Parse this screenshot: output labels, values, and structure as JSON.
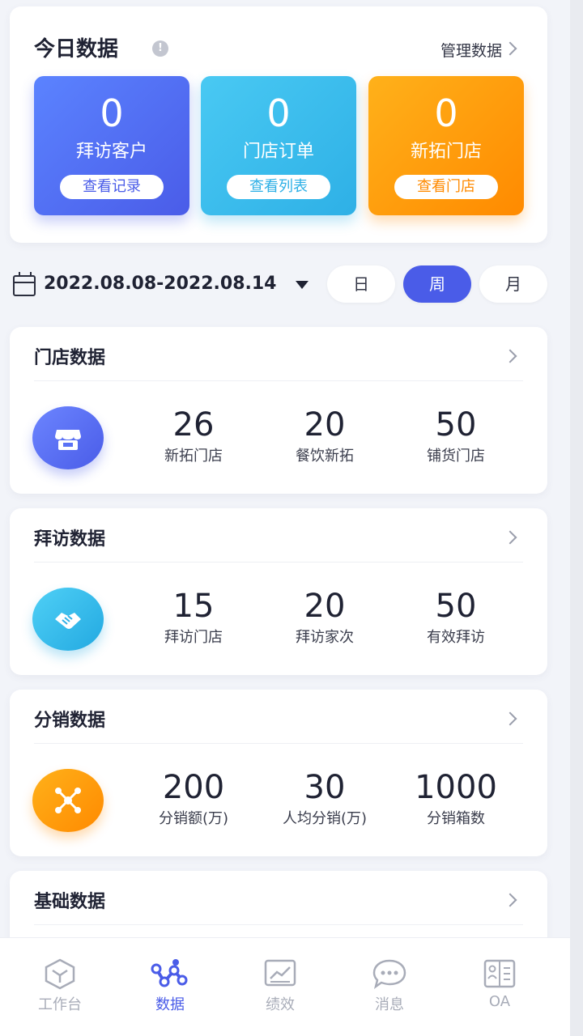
{
  "today": {
    "title": "今日数据",
    "manage_label": "管理数据",
    "tiles": [
      {
        "value": "0",
        "label": "拜访客户",
        "button": "查看记录"
      },
      {
        "value": "0",
        "label": "门店订单",
        "button": "查看列表"
      },
      {
        "value": "0",
        "label": "新拓门店",
        "button": "查看门店"
      }
    ]
  },
  "date_range": "2022.08.08-2022.08.14",
  "period_tabs": [
    "日",
    "周",
    "月"
  ],
  "selected_period": "周",
  "sections": [
    {
      "title": "门店数据",
      "icon": "store-icon",
      "metrics": [
        {
          "value": "26",
          "label": "新拓门店"
        },
        {
          "value": "20",
          "label": "餐饮新拓"
        },
        {
          "value": "50",
          "label": "铺货门店"
        }
      ]
    },
    {
      "title": "拜访数据",
      "icon": "handshake-icon",
      "metrics": [
        {
          "value": "15",
          "label": "拜访门店"
        },
        {
          "value": "20",
          "label": "拜访家次"
        },
        {
          "value": "50",
          "label": "有效拜访"
        }
      ]
    },
    {
      "title": "分销数据",
      "icon": "network-icon",
      "metrics": [
        {
          "value": "200",
          "label": "分销额(万)"
        },
        {
          "value": "30",
          "label": "人均分销(万)"
        },
        {
          "value": "1000",
          "label": "分销箱数"
        }
      ]
    },
    {
      "title": "基础数据"
    }
  ],
  "tabbar": [
    {
      "label": "工作台",
      "icon": "workbench-icon"
    },
    {
      "label": "数据",
      "icon": "data-icon"
    },
    {
      "label": "绩效",
      "icon": "performance-icon"
    },
    {
      "label": "消息",
      "icon": "message-icon"
    },
    {
      "label": "OA",
      "icon": "oa-icon"
    }
  ],
  "active_tab": "数据",
  "colors": {
    "accent": "#4a5ce8",
    "cyan": "#2eb0e6",
    "orange": "#ff8a00",
    "background": "#f2f4f9"
  }
}
